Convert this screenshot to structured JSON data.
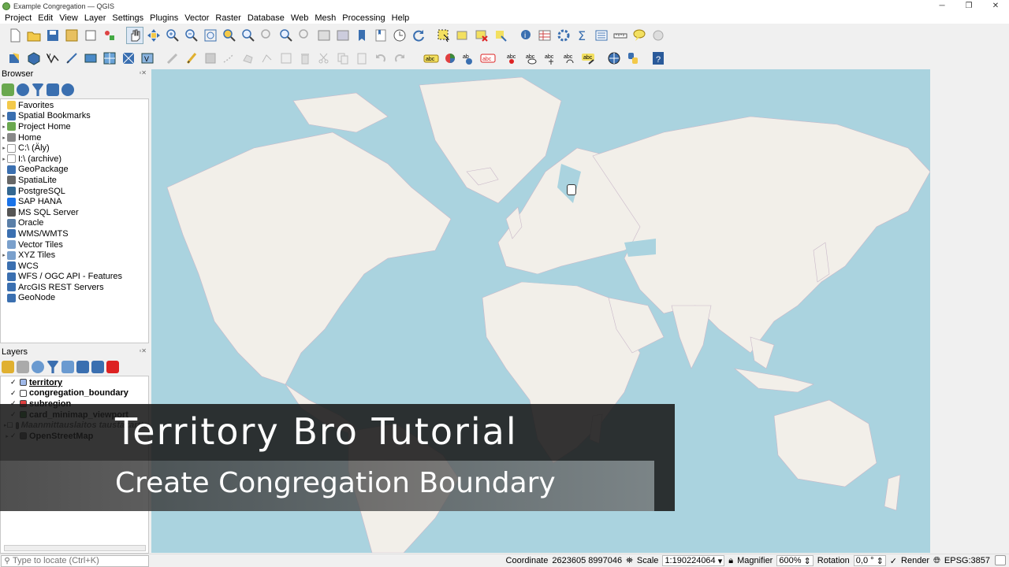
{
  "window": {
    "title": "Example Congregation — QGIS"
  },
  "menu": [
    "Project",
    "Edit",
    "View",
    "Layer",
    "Settings",
    "Plugins",
    "Vector",
    "Raster",
    "Database",
    "Web",
    "Mesh",
    "Processing",
    "Help"
  ],
  "browser": {
    "title": "Browser",
    "items": [
      {
        "label": "Favorites",
        "icon": "star-icon",
        "arrow": false
      },
      {
        "label": "Spatial Bookmarks",
        "icon": "bookmark-icon",
        "arrow": true
      },
      {
        "label": "Project Home",
        "icon": "project-home-icon",
        "arrow": true
      },
      {
        "label": "Home",
        "icon": "home-icon",
        "arrow": true
      },
      {
        "label": "C:\\ (Äly)",
        "icon": "drive-icon",
        "arrow": true
      },
      {
        "label": "I:\\ (archive)",
        "icon": "drive-icon",
        "arrow": true
      },
      {
        "label": "GeoPackage",
        "icon": "geopackage-icon",
        "arrow": false
      },
      {
        "label": "SpatiaLite",
        "icon": "spatialite-icon",
        "arrow": false
      },
      {
        "label": "PostgreSQL",
        "icon": "postgresql-icon",
        "arrow": false
      },
      {
        "label": "SAP HANA",
        "icon": "sap-hana-icon",
        "arrow": false
      },
      {
        "label": "MS SQL Server",
        "icon": "mssql-icon",
        "arrow": false
      },
      {
        "label": "Oracle",
        "icon": "oracle-icon",
        "arrow": false
      },
      {
        "label": "WMS/WMTS",
        "icon": "wms-icon",
        "arrow": false
      },
      {
        "label": "Vector Tiles",
        "icon": "vector-tiles-icon",
        "arrow": false
      },
      {
        "label": "XYZ Tiles",
        "icon": "xyz-tiles-icon",
        "arrow": true
      },
      {
        "label": "WCS",
        "icon": "wcs-icon",
        "arrow": false
      },
      {
        "label": "WFS / OGC API - Features",
        "icon": "wfs-icon",
        "arrow": false
      },
      {
        "label": "ArcGIS REST Servers",
        "icon": "arcgis-icon",
        "arrow": false
      },
      {
        "label": "GeoNode",
        "icon": "geonode-icon",
        "arrow": false
      }
    ]
  },
  "layers": {
    "title": "Layers",
    "items": [
      {
        "label": "territory",
        "checked": true,
        "icon": "polygon-layer-icon",
        "color": "#9fb8e8",
        "italic": false,
        "underline": true
      },
      {
        "label": "congregation_boundary",
        "checked": true,
        "icon": "polygon-layer-icon",
        "color": "#ffffff",
        "italic": false,
        "underline": false
      },
      {
        "label": "subregion",
        "checked": true,
        "icon": "polygon-layer-icon",
        "color": "#e04040",
        "italic": false,
        "underline": false
      },
      {
        "label": "card_minimap_viewport",
        "checked": true,
        "icon": "polygon-layer-icon",
        "color": "#3a8a3a",
        "italic": false,
        "underline": false
      },
      {
        "label": "Maanmittauslaitos taustakartta",
        "checked": false,
        "icon": "raster-layer-icon",
        "color": "#666666",
        "italic": true,
        "underline": false
      },
      {
        "label": "OpenStreetMap",
        "checked": true,
        "icon": "raster-layer-icon",
        "color": "#666666",
        "italic": false,
        "underline": false
      }
    ]
  },
  "banner": {
    "title": "Territory Bro Tutorial",
    "subtitle": "Create Congregation Boundary"
  },
  "status": {
    "locate_placeholder": "Type to locate (Ctrl+K)",
    "coordinate_label": "Coordinate",
    "coordinate": "2623605 8997046",
    "scale_label": "Scale",
    "scale": "1:190224064",
    "magnifier_label": "Magnifier",
    "magnifier": "600%",
    "rotation_label": "Rotation",
    "rotation": "0,0 °",
    "render_label": "Render",
    "crs": "EPSG:3857"
  },
  "colors": {
    "water": "#aad3df",
    "land": "#f2efe9",
    "panel_bg": "#ffffff",
    "chrome": "#f0f0f0"
  }
}
